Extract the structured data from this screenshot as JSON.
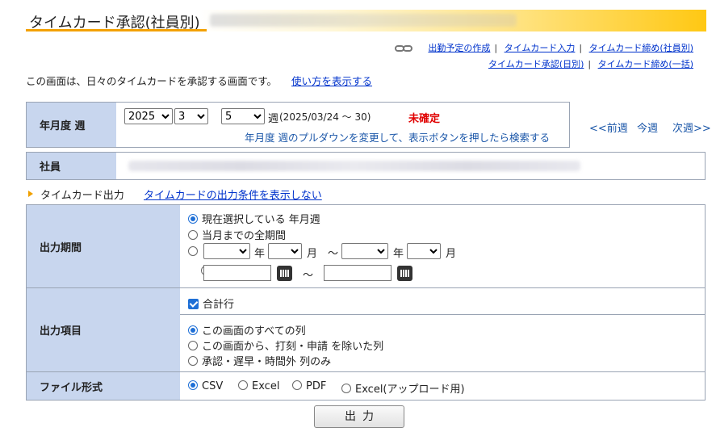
{
  "page": {
    "title": "タイムカード承認(社員別)"
  },
  "links_row1": [
    "出勤予定の作成",
    "タイムカード入力",
    "タイムカード締め(社員別)"
  ],
  "links_row2": [
    "タイムカード承認(日別)",
    "タイムカード締め(一括)"
  ],
  "intro": {
    "text": "この画面は、日々のタイムカードを承認する画面です。",
    "help_link": "使い方を表示する"
  },
  "period": {
    "label": "年月度 週",
    "year": "2025",
    "month": "3",
    "week": "5",
    "week_suffix": "週",
    "range": "(2025/03/24 〜 30)",
    "status": "未確定",
    "hint": "年月度 週のプルダウンを変更して、表示ボタンを押したら検索する",
    "prev": "<<前週",
    "current": "今週",
    "next": "次週>>"
  },
  "employee": {
    "label": "社員"
  },
  "output_section": {
    "title": "タイムカード出力",
    "toggle_link": "タイムカードの出力条件を表示しない"
  },
  "output_period": {
    "label": "出力期間",
    "opt1": "現在選択している 年月週",
    "opt2": "当月までの全期間",
    "year_unit": "年",
    "month_unit": "月",
    "tilde": "〜"
  },
  "output_items": {
    "label": "出力項目",
    "total_row": "合計行",
    "opt1": "この画面のすべての列",
    "opt2": "この画面から、打刻・申請 を除いた列",
    "opt3": "承認・遅早・時間外 列のみ"
  },
  "file_format": {
    "label": "ファイル形式",
    "opts": [
      "CSV",
      "Excel",
      "PDF",
      "Excel(アップロード用)"
    ]
  },
  "submit": {
    "label": "出力"
  },
  "colors": {
    "accent": "#f3a100",
    "label_bg": "#c8d6ee",
    "link": "#0033cc",
    "status_red": "#e00000"
  }
}
